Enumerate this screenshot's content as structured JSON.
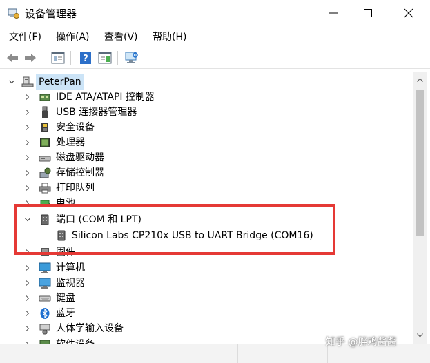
{
  "window": {
    "title": "设备管理器"
  },
  "menu": {
    "items": [
      {
        "label": "文件(F)"
      },
      {
        "label": "操作(A)"
      },
      {
        "label": "查看(V)"
      },
      {
        "label": "帮助(H)"
      }
    ]
  },
  "toolbar": {
    "icons": [
      "back-arrow-icon",
      "forward-arrow-icon",
      "properties-icon",
      "help-icon",
      "action-pane-icon",
      "scan-hardware-icon"
    ]
  },
  "tree": {
    "root": {
      "label": "PeterPan",
      "icon": "computer-icon",
      "expanded": true
    },
    "items": [
      {
        "label": "IDE ATA/ATAPI 控制器",
        "icon": "ide-controller-icon",
        "expanded": false
      },
      {
        "label": "USB 连接器管理器",
        "icon": "usb-connector-icon",
        "expanded": false
      },
      {
        "label": "安全设备",
        "icon": "security-device-icon",
        "expanded": false
      },
      {
        "label": "处理器",
        "icon": "processor-icon",
        "expanded": false
      },
      {
        "label": "磁盘驱动器",
        "icon": "disk-drive-icon",
        "expanded": false
      },
      {
        "label": "存储控制器",
        "icon": "storage-controller-icon",
        "expanded": false
      },
      {
        "label": "打印队列",
        "icon": "printer-icon",
        "expanded": false
      },
      {
        "label": "电池",
        "icon": "battery-icon",
        "expanded": false
      },
      {
        "label": "端口 (COM 和 LPT)",
        "icon": "port-icon",
        "expanded": true
      },
      {
        "label": "Silicon Labs CP210x USB to UART Bridge (COM16)",
        "icon": "port-icon",
        "child": true
      },
      {
        "label": "固件",
        "icon": "firmware-icon",
        "expanded": false
      },
      {
        "label": "计算机",
        "icon": "computer-monitor-icon",
        "expanded": false
      },
      {
        "label": "监视器",
        "icon": "monitor-icon",
        "expanded": false
      },
      {
        "label": "键盘",
        "icon": "keyboard-icon",
        "expanded": false
      },
      {
        "label": "蓝牙",
        "icon": "bluetooth-icon",
        "expanded": false
      },
      {
        "label": "人体学输入设备",
        "icon": "hid-icon",
        "expanded": false
      },
      {
        "label": "软件设备",
        "icon": "software-device-icon",
        "expanded": false
      }
    ]
  },
  "overlay": {
    "highlight_color": "#e53935",
    "watermark": "知乎 @胖鸡酱酱"
  },
  "colors": {
    "selection": "#cce4f7",
    "accent": "#1e6fd0"
  }
}
